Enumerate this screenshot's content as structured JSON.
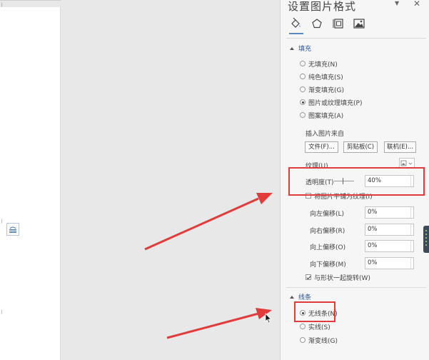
{
  "document": {
    "margin_marks": [
      ")",
      ")",
      ")"
    ]
  },
  "pane": {
    "title": "设置图片格式",
    "dropdown_glyph": "▼",
    "close_glyph": "✕",
    "tabs": [
      {
        "name": "fill-line",
        "icon": "paint-bucket-icon",
        "selected": true
      },
      {
        "name": "effects",
        "icon": "pentagon-icon",
        "selected": false
      },
      {
        "name": "layout-properties",
        "icon": "size-properties-icon",
        "selected": false
      },
      {
        "name": "picture",
        "icon": "picture-icon",
        "selected": false
      }
    ]
  },
  "fill": {
    "header": "填充",
    "options": [
      {
        "label": "无填充(N)",
        "selected": false
      },
      {
        "label": "纯色填充(S)",
        "selected": false
      },
      {
        "label": "渐变填充(G)",
        "selected": false
      },
      {
        "label": "图片或纹理填充(P)",
        "selected": true
      },
      {
        "label": "图案填充(A)",
        "selected": false
      }
    ],
    "insert_from_label": "插入图片来自",
    "buttons": {
      "file": "文件(F)...",
      "clipboard": "剪贴板(C)",
      "online": "联机(E)..."
    },
    "texture_label": "纹理(U)",
    "transparency_label": "透明度(T)",
    "transparency_value": "40%",
    "tile_label": "将图片平铺为纹理(I)",
    "tile_checked": false,
    "offsets": [
      {
        "label": "向左偏移(L)",
        "value": "0%"
      },
      {
        "label": "向右偏移(R)",
        "value": "0%"
      },
      {
        "label": "向上偏移(O)",
        "value": "0%"
      },
      {
        "label": "向下偏移(M)",
        "value": "0%"
      }
    ],
    "rotate_label": "与形状一起旋转(W)",
    "rotate_checked": true
  },
  "line": {
    "header": "线条",
    "options": [
      {
        "label": "无线条(N)",
        "selected": true
      },
      {
        "label": "实线(S)",
        "selected": false
      },
      {
        "label": "渐变线(G)",
        "selected": false
      }
    ]
  },
  "colors": {
    "highlight": "#e23b3b",
    "accent": "#2b579a"
  }
}
